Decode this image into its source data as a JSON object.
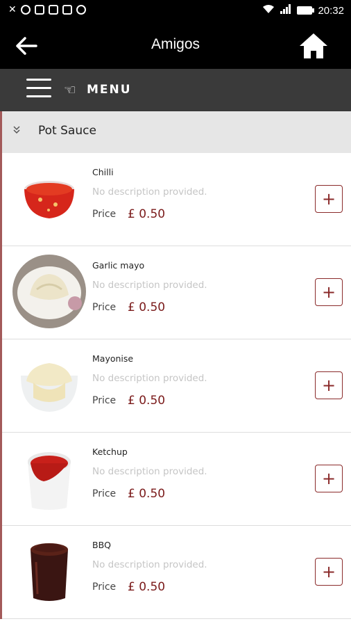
{
  "status_bar": {
    "time": "20:32"
  },
  "header": {
    "title": "Amigos"
  },
  "menu_bar": {
    "label": "MENU"
  },
  "category": {
    "label": "Pot Sauce"
  },
  "items": [
    {
      "name": "Chilli",
      "description": "No description provided.",
      "price_label": "Price",
      "price": "£ 0.50"
    },
    {
      "name": "Garlic mayo",
      "description": "No description provided.",
      "price_label": "Price",
      "price": "£ 0.50"
    },
    {
      "name": "Mayonise",
      "description": "No description provided.",
      "price_label": "Price",
      "price": "£ 0.50"
    },
    {
      "name": "Ketchup",
      "description": "No description provided.",
      "price_label": "Price",
      "price": "£ 0.50"
    },
    {
      "name": "BBQ",
      "description": "No description provided.",
      "price_label": "Price",
      "price": "£ 0.50"
    }
  ],
  "colors": {
    "accent": "#7a1a1a",
    "header_bg": "#000000",
    "menubar_bg": "#3a3a3a"
  }
}
